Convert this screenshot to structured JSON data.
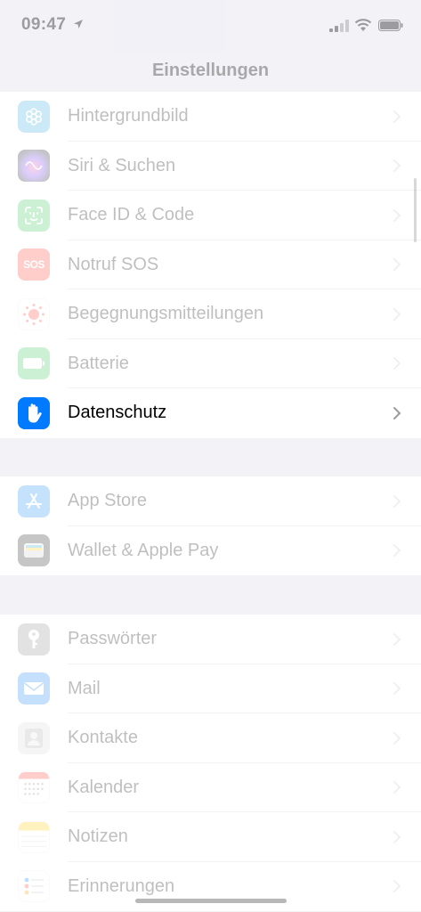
{
  "status": {
    "time": "09:47"
  },
  "nav": {
    "title": "Einstellungen"
  },
  "group1": [
    {
      "label": "Hintergrundbild",
      "icon": "wallpaper-icon",
      "color": "#34aadc"
    },
    {
      "label": "Siri & Suchen",
      "icon": "siri-icon",
      "color": "#2a2a3a"
    },
    {
      "label": "Face ID & Code",
      "icon": "face-id-icon",
      "color": "#34c759"
    },
    {
      "label": "Notruf SOS",
      "icon": "sos-icon",
      "color": "#ff3b30",
      "icon_text": "SOS"
    },
    {
      "label": "Begegnungsmitteilungen",
      "icon": "exposure-notifications-icon",
      "color": "#ff3b30"
    },
    {
      "label": "Batterie",
      "icon": "battery-icon",
      "color": "#34c759"
    },
    {
      "label": "Datenschutz",
      "icon": "hand-icon",
      "color": "#007aff"
    }
  ],
  "group2": [
    {
      "label": "App Store",
      "icon": "app-store-icon",
      "color": "#1c8ef9"
    },
    {
      "label": "Wallet & Apple Pay",
      "icon": "wallet-icon",
      "color": "#222222"
    }
  ],
  "group3": [
    {
      "label": "Passwörter",
      "icon": "key-icon",
      "color": "#8e8e93"
    },
    {
      "label": "Mail",
      "icon": "mail-icon",
      "color": "#1e88f5"
    },
    {
      "label": "Kontakte",
      "icon": "contacts-icon",
      "color": "#a9a9ae"
    },
    {
      "label": "Kalender",
      "icon": "calendar-icon",
      "color": "#ff3b30"
    },
    {
      "label": "Notizen",
      "icon": "notes-icon",
      "color": "#ffcc00"
    },
    {
      "label": "Erinnerungen",
      "icon": "reminders-icon",
      "color": "#ff9500"
    }
  ]
}
